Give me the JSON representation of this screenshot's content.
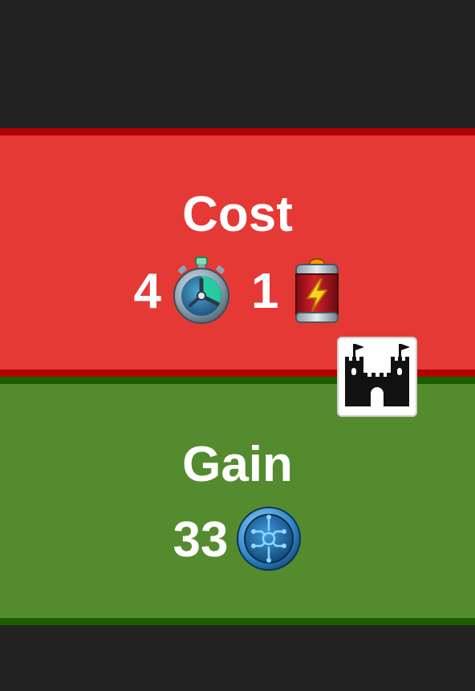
{
  "cost": {
    "title": "Cost",
    "items": [
      {
        "amount": "4",
        "icon": "stopwatch-icon"
      },
      {
        "amount": "1",
        "icon": "battery-icon"
      }
    ]
  },
  "gain": {
    "title": "Gain",
    "items": [
      {
        "amount": "33",
        "icon": "circuit-coin-icon"
      }
    ]
  },
  "badge": {
    "icon": "castle-icon"
  },
  "colors": {
    "background": "#222222",
    "cost": "#e53935",
    "cost_border": "#b00000",
    "gain": "#558b2f",
    "gain_border": "#1b5e00"
  }
}
